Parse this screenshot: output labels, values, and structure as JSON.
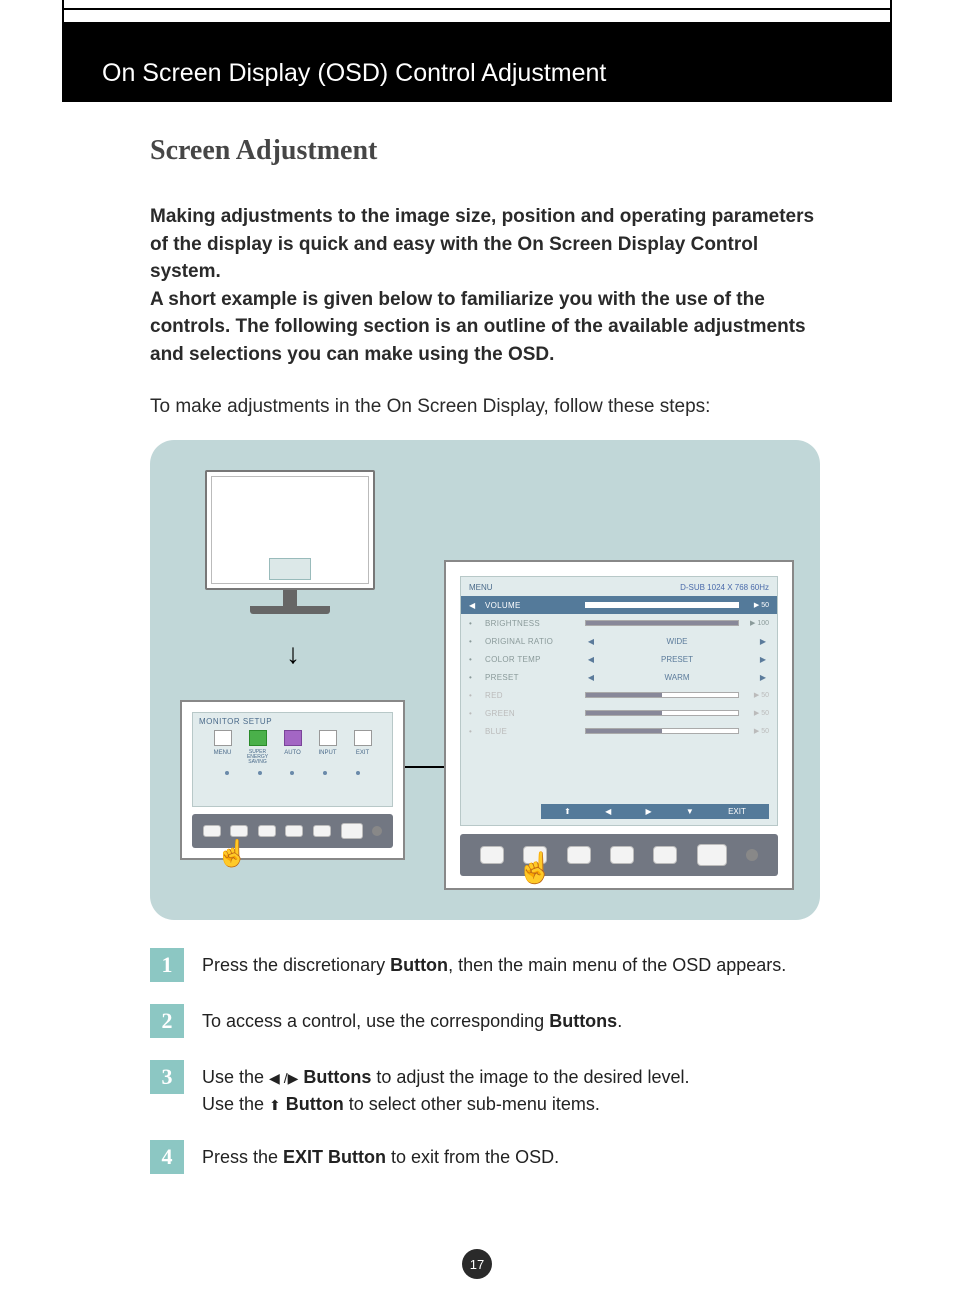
{
  "header": {
    "title": "On Screen Display (OSD) Control Adjustment"
  },
  "section_title": "Screen Adjustment",
  "intro_bold": "Making adjustments to the image size, position and operating parameters of the display is quick and easy with the On Screen Display Control system.\nA short example is given below to familiarize you with the use of the controls. The following section is an outline of the available adjustments and selections you can make using the OSD.",
  "intro_reg": "To make adjustments in the On Screen Display, follow these steps:",
  "setup_panel": {
    "title": "MONITOR SETUP",
    "labels": [
      "MENU",
      "SUPER ENERGY SAVING",
      "AUTO",
      "INPUT",
      "EXIT"
    ]
  },
  "osd": {
    "menu_label": "MENU",
    "signal": "D-SUB 1024 X 768 60Hz",
    "rows": [
      {
        "label": "VOLUME",
        "value": 50,
        "pct": 50,
        "hl": true
      },
      {
        "label": "BRIGHTNESS",
        "value": 100,
        "pct": 100
      },
      {
        "label": "ORIGINAL RATIO",
        "sel": "WIDE"
      },
      {
        "label": "COLOR TEMP",
        "sel": "PRESET"
      },
      {
        "label": "PRESET",
        "sel": "WARM"
      },
      {
        "label": "RED",
        "value": 50,
        "pct": 50,
        "faded": true
      },
      {
        "label": "GREEN",
        "value": 50,
        "pct": 50,
        "faded": true
      },
      {
        "label": "BLUE",
        "value": 50,
        "pct": 50,
        "faded": true
      }
    ],
    "nav": [
      "⬆",
      "◀",
      "▶",
      "▼",
      "EXIT"
    ]
  },
  "steps": [
    {
      "n": "1",
      "a": "Press the discretionary ",
      "b": "Button",
      "c": ", then the main menu of the OSD appears."
    },
    {
      "n": "2",
      "a": "To access a control, use the corresponding ",
      "b": "Buttons",
      "c": "."
    },
    {
      "n": "3",
      "l1a": "Use the  ",
      "l1icon": "◀ /▶",
      "l1b": "  Buttons",
      "l1c": " to adjust the image to the desired level.",
      "l2a": "Use the  ",
      "l2icon": "⬆",
      "l2b": "  Button",
      "l2c": " to select other sub-menu items."
    },
    {
      "n": "4",
      "a": "Press the ",
      "b": "EXIT Button",
      "c": " to exit from the OSD."
    }
  ],
  "page_number": "17"
}
